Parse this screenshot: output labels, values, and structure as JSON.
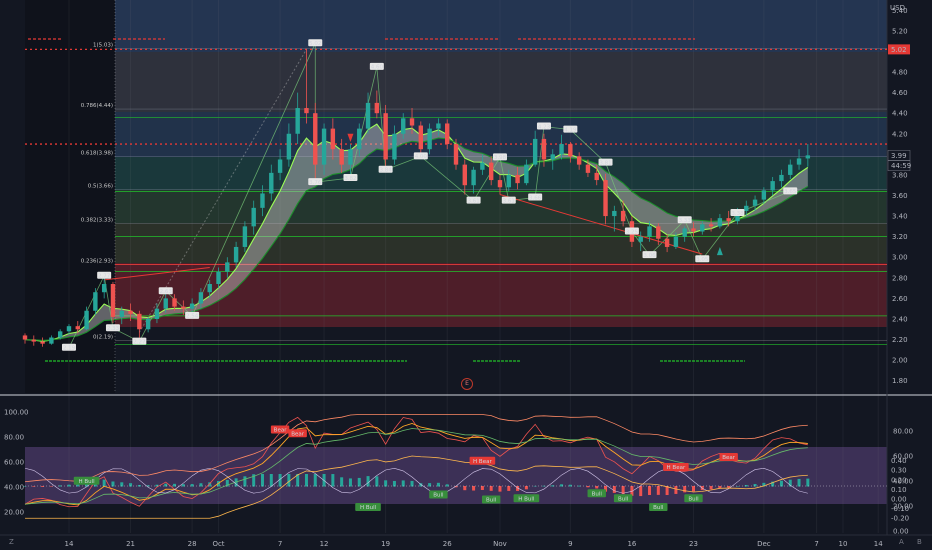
{
  "chart_data": [
    {
      "type": "candlestick",
      "currency": "USD",
      "y_ticks": [
        "1.80",
        "2.00",
        "2.20",
        "2.40",
        "2.60",
        "2.80",
        "3.00",
        "3.20",
        "3.40",
        "3.60",
        "3.80",
        "4.00",
        "4.20",
        "4.40",
        "4.60",
        "4.80",
        "5.00",
        "5.20",
        "5.40"
      ],
      "ylim": [
        1.7,
        5.5
      ],
      "x_ticks": [
        {
          "label": "14",
          "day": 14
        },
        {
          "label": "21",
          "day": 21
        },
        {
          "label": "28",
          "day": 28
        },
        {
          "label": "Oct",
          "day": 31
        },
        {
          "label": "7",
          "day": 38
        },
        {
          "label": "12",
          "day": 43
        },
        {
          "label": "19",
          "day": 50
        },
        {
          "label": "26",
          "day": 57
        },
        {
          "label": "Nov",
          "day": 63
        },
        {
          "label": "9",
          "day": 71
        },
        {
          "label": "16",
          "day": 78
        },
        {
          "label": "23",
          "day": 85
        },
        {
          "label": "Dec",
          "day": 93
        },
        {
          "label": "7",
          "day": 99
        },
        {
          "label": "10",
          "day": 102
        },
        {
          "label": "14",
          "day": 106
        }
      ],
      "price_tags": [
        {
          "label": "5.02",
          "value": 5.02,
          "color": "#e53935"
        },
        {
          "label": "3.99",
          "value": 3.99,
          "color": "#ffffff"
        },
        {
          "label": "44:59",
          "value": 3.89,
          "color": "#ffffff"
        }
      ],
      "fib_levels": [
        {
          "label": "1(5.03)",
          "value": 5.03
        },
        {
          "label": "0.786(4.44)",
          "value": 4.44
        },
        {
          "label": "0.618(3.98)",
          "value": 3.98
        },
        {
          "label": "0.5(3.66)",
          "value": 3.66
        },
        {
          "label": "0.382(3.33)",
          "value": 3.33
        },
        {
          "label": "0.236(2.93)",
          "value": 2.93
        },
        {
          "label": "0(2.19)",
          "value": 2.19
        }
      ],
      "pivot_labels": [
        {
          "text": "2.19",
          "day": 14,
          "value": 2.12
        },
        {
          "text": "2.77",
          "day": 18,
          "value": 2.82
        },
        {
          "text": "2.33",
          "day": 19,
          "value": 2.31
        },
        {
          "text": "2.27",
          "day": 22,
          "value": 2.18
        },
        {
          "text": "2.63",
          "day": 25,
          "value": 2.67
        },
        {
          "text": "2.54",
          "day": 28,
          "value": 2.43
        },
        {
          "text": "5.02",
          "day": 42,
          "value": 5.08
        },
        {
          "text": "3.76",
          "day": 42,
          "value": 3.73
        },
        {
          "text": "3.82",
          "day": 46,
          "value": 3.77
        },
        {
          "text": "4.60",
          "day": 49,
          "value": 4.85
        },
        {
          "text": "3.84",
          "day": 50,
          "value": 3.85
        },
        {
          "text": "4.00",
          "day": 54,
          "value": 3.98
        },
        {
          "text": "3.61",
          "day": 60,
          "value": 3.55
        },
        {
          "text": "3.98",
          "day": 63,
          "value": 3.97
        },
        {
          "text": "3.61",
          "day": 64,
          "value": 3.55
        },
        {
          "text": "4.23",
          "day": 68,
          "value": 4.27
        },
        {
          "text": "3.66",
          "day": 67,
          "value": 3.58
        },
        {
          "text": "4.19",
          "day": 71,
          "value": 4.24
        },
        {
          "text": "3.81",
          "day": 75,
          "value": 3.92
        },
        {
          "text": "3.25",
          "day": 78,
          "value": 3.25
        },
        {
          "text": "3.06",
          "day": 80,
          "value": 3.02
        },
        {
          "text": "3.33",
          "day": 84,
          "value": 3.36
        },
        {
          "text": "3.05",
          "day": 86,
          "value": 2.98
        },
        {
          "text": "3.38",
          "day": 90,
          "value": 3.43
        },
        {
          "text": "3.65",
          "day": 96,
          "value": 3.64
        }
      ],
      "candles": [
        [
          9,
          2.24,
          2.26,
          2.16,
          2.2
        ],
        [
          10,
          2.2,
          2.24,
          2.14,
          2.18
        ],
        [
          11,
          2.18,
          2.22,
          2.13,
          2.16
        ],
        [
          12,
          2.16,
          2.24,
          2.15,
          2.22
        ],
        [
          13,
          2.22,
          2.3,
          2.2,
          2.28
        ],
        [
          14,
          2.28,
          2.35,
          2.25,
          2.33
        ],
        [
          15,
          2.33,
          2.38,
          2.26,
          2.3
        ],
        [
          16,
          2.3,
          2.52,
          2.29,
          2.48
        ],
        [
          17,
          2.48,
          2.7,
          2.44,
          2.66
        ],
        [
          18,
          2.66,
          2.82,
          2.6,
          2.74
        ],
        [
          19,
          2.74,
          2.76,
          2.36,
          2.42
        ],
        [
          20,
          2.42,
          2.52,
          2.35,
          2.48
        ],
        [
          21,
          2.48,
          2.55,
          2.38,
          2.45
        ],
        [
          22,
          2.45,
          2.48,
          2.22,
          2.3
        ],
        [
          23,
          2.3,
          2.42,
          2.27,
          2.4
        ],
        [
          24,
          2.4,
          2.55,
          2.36,
          2.5
        ],
        [
          25,
          2.5,
          2.66,
          2.46,
          2.6
        ],
        [
          26,
          2.6,
          2.64,
          2.48,
          2.52
        ],
        [
          27,
          2.52,
          2.58,
          2.44,
          2.5
        ],
        [
          28,
          2.5,
          2.6,
          2.43,
          2.55
        ],
        [
          29,
          2.55,
          2.7,
          2.5,
          2.66
        ],
        [
          30,
          2.66,
          2.78,
          2.6,
          2.74
        ],
        [
          31,
          2.74,
          2.9,
          2.7,
          2.86
        ],
        [
          32,
          2.86,
          3.0,
          2.8,
          2.95
        ],
        [
          33,
          2.95,
          3.15,
          2.9,
          3.1
        ],
        [
          34,
          3.1,
          3.35,
          3.05,
          3.3
        ],
        [
          35,
          3.3,
          3.55,
          3.22,
          3.48
        ],
        [
          36,
          3.48,
          3.7,
          3.4,
          3.62
        ],
        [
          37,
          3.62,
          3.9,
          3.55,
          3.82
        ],
        [
          38,
          3.82,
          4.05,
          3.75,
          3.95
        ],
        [
          39,
          3.95,
          4.3,
          3.88,
          4.2
        ],
        [
          40,
          4.2,
          4.6,
          4.1,
          4.45
        ],
        [
          41,
          4.45,
          5.02,
          4.3,
          4.4
        ],
        [
          42,
          4.4,
          4.5,
          3.73,
          3.9
        ],
        [
          43,
          3.9,
          4.3,
          3.8,
          4.25
        ],
        [
          44,
          4.25,
          4.35,
          3.95,
          4.05
        ],
        [
          45,
          4.05,
          4.15,
          3.82,
          3.9
        ],
        [
          46,
          3.9,
          4.1,
          3.77,
          4.05
        ],
        [
          47,
          4.05,
          4.3,
          3.98,
          4.25
        ],
        [
          48,
          4.25,
          4.6,
          4.2,
          4.5
        ],
        [
          49,
          4.5,
          4.62,
          4.35,
          4.4
        ],
        [
          50,
          4.4,
          4.48,
          3.84,
          3.95
        ],
        [
          51,
          3.95,
          4.28,
          3.9,
          4.2
        ],
        [
          52,
          4.2,
          4.4,
          4.15,
          4.35
        ],
        [
          53,
          4.35,
          4.45,
          4.2,
          4.28
        ],
        [
          54,
          4.28,
          4.32,
          3.98,
          4.05
        ],
        [
          55,
          4.05,
          4.3,
          4.0,
          4.25
        ],
        [
          56,
          4.25,
          4.35,
          4.18,
          4.3
        ],
        [
          57,
          4.3,
          4.34,
          4.05,
          4.1
        ],
        [
          58,
          4.1,
          4.15,
          3.85,
          3.9
        ],
        [
          59,
          3.9,
          3.95,
          3.61,
          3.7
        ],
        [
          60,
          3.7,
          3.88,
          3.62,
          3.85
        ],
        [
          61,
          3.85,
          4.0,
          3.8,
          3.92
        ],
        [
          62,
          3.92,
          3.98,
          3.7,
          3.75
        ],
        [
          63,
          3.75,
          3.8,
          3.61,
          3.68
        ],
        [
          64,
          3.68,
          3.85,
          3.64,
          3.8
        ],
        [
          65,
          3.8,
          3.88,
          3.66,
          3.72
        ],
        [
          66,
          3.72,
          3.95,
          3.7,
          3.9
        ],
        [
          67,
          3.9,
          4.23,
          3.88,
          4.15
        ],
        [
          68,
          4.15,
          4.2,
          3.88,
          3.95
        ],
        [
          69,
          3.95,
          4.05,
          3.85,
          4.0
        ],
        [
          70,
          4.0,
          4.19,
          3.95,
          4.1
        ],
        [
          71,
          4.1,
          4.12,
          3.92,
          3.98
        ],
        [
          72,
          3.98,
          4.02,
          3.85,
          3.9
        ],
        [
          73,
          3.9,
          3.95,
          3.78,
          3.82
        ],
        [
          74,
          3.82,
          3.9,
          3.7,
          3.75
        ],
        [
          75,
          3.75,
          3.81,
          3.32,
          3.4
        ],
        [
          76,
          3.4,
          3.5,
          3.25,
          3.45
        ],
        [
          77,
          3.45,
          3.55,
          3.3,
          3.35
        ],
        [
          78,
          3.35,
          3.4,
          3.1,
          3.15
        ],
        [
          79,
          3.15,
          3.25,
          3.06,
          3.2
        ],
        [
          80,
          3.2,
          3.35,
          3.15,
          3.3
        ],
        [
          81,
          3.3,
          3.33,
          3.12,
          3.18
        ],
        [
          82,
          3.18,
          3.22,
          3.05,
          3.1
        ],
        [
          83,
          3.1,
          3.24,
          3.08,
          3.2
        ],
        [
          84,
          3.2,
          3.3,
          3.15,
          3.28
        ],
        [
          85,
          3.28,
          3.34,
          3.2,
          3.25
        ],
        [
          86,
          3.25,
          3.35,
          3.22,
          3.32
        ],
        [
          87,
          3.32,
          3.38,
          3.25,
          3.3
        ],
        [
          88,
          3.3,
          3.42,
          3.28,
          3.38
        ],
        [
          89,
          3.38,
          3.45,
          3.3,
          3.35
        ],
        [
          90,
          3.35,
          3.48,
          3.32,
          3.45
        ],
        [
          91,
          3.45,
          3.55,
          3.4,
          3.5
        ],
        [
          92,
          3.5,
          3.6,
          3.45,
          3.56
        ],
        [
          93,
          3.56,
          3.68,
          3.52,
          3.65
        ],
        [
          94,
          3.65,
          3.78,
          3.6,
          3.74
        ],
        [
          95,
          3.74,
          3.85,
          3.68,
          3.8
        ],
        [
          96,
          3.8,
          3.95,
          3.76,
          3.9
        ],
        [
          97,
          3.9,
          4.05,
          3.85,
          3.96
        ],
        [
          98,
          3.96,
          4.1,
          3.88,
          3.99
        ]
      ]
    },
    {
      "type": "line",
      "panel": "oscillator",
      "left_ticks": [
        "20.00",
        "40.00",
        "60.00",
        "80.00",
        "100.00"
      ],
      "left_ylim": [
        8,
        108
      ],
      "right_ticks": [
        "0.00",
        "20.00",
        "40.00",
        "60.00",
        "80.00"
      ],
      "right_signed_ticks": [
        {
          "label": "0.40",
          "value": 0.4
        },
        {
          "label": "0.30",
          "value": 0.3
        },
        {
          "label": "0.20",
          "value": 0.2
        },
        {
          "label": "0.10",
          "value": 0.1
        },
        {
          "label": "0.00",
          "value": 0.0
        },
        {
          "label": "-0.10",
          "value": -0.1
        },
        {
          "label": "-0.20",
          "value": -0.2
        }
      ],
      "signals": [
        {
          "text": "Bear",
          "day": 38,
          "value": 86,
          "type": "bear"
        },
        {
          "text": "Bear",
          "day": 40,
          "value": 83,
          "type": "bear"
        },
        {
          "text": "H Bear",
          "day": 61,
          "value": 61,
          "type": "bear"
        },
        {
          "text": "H Bear",
          "day": 83,
          "value": 56,
          "type": "bear"
        },
        {
          "text": "Bear",
          "day": 89,
          "value": 64,
          "type": "bear"
        },
        {
          "text": "H Bull",
          "day": 16,
          "value": 45,
          "type": "bull"
        },
        {
          "text": "H Bull",
          "day": 48,
          "value": 24,
          "type": "bull"
        },
        {
          "text": "Bull",
          "day": 56,
          "value": 34,
          "type": "bull"
        },
        {
          "text": "Bull",
          "day": 62,
          "value": 30,
          "type": "bull"
        },
        {
          "text": "H Bull",
          "day": 66,
          "value": 31,
          "type": "bull"
        },
        {
          "text": "Bull",
          "day": 74,
          "value": 35,
          "type": "bull"
        },
        {
          "text": "Bull",
          "day": 77,
          "value": 31,
          "type": "bull"
        },
        {
          "text": "Bull",
          "day": 81,
          "value": 24,
          "type": "bull"
        },
        {
          "text": "Bull",
          "day": 85,
          "value": 31,
          "type": "bull"
        }
      ]
    }
  ],
  "top_axis_label": "USD",
  "event_marker": "E",
  "bottom_corner_labels": {
    "left": "Z",
    "right_a": "A",
    "right_b": "B"
  },
  "colors": {
    "bull": "#26a69a",
    "bear": "#ef5350",
    "green_line": "#22c02a",
    "red_line": "#e53935",
    "fib_blue": "#4e85c8"
  }
}
